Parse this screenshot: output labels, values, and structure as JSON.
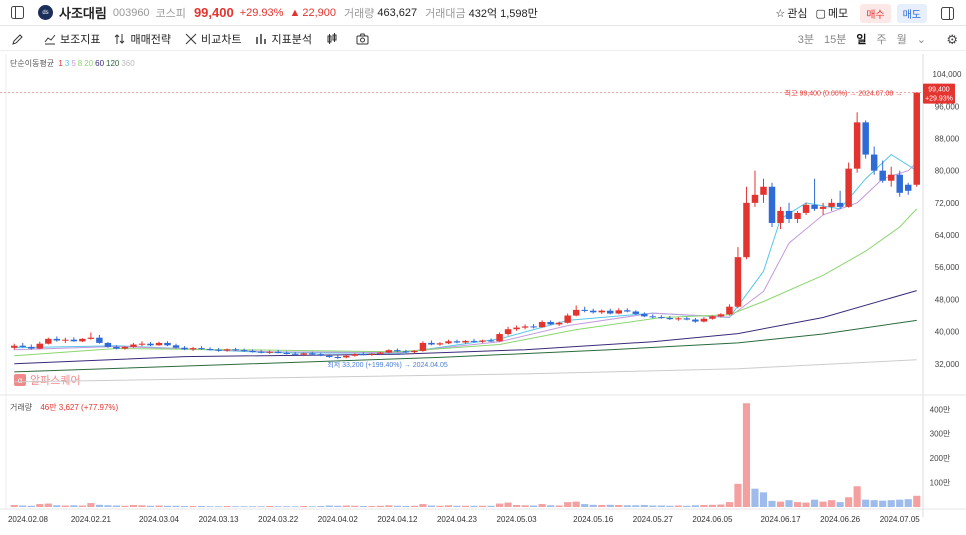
{
  "header": {
    "logo_text": "ds",
    "name": "사조대림",
    "code": "003960",
    "market": "코스피",
    "price": "99,400",
    "change_pct": "+29.93%",
    "change_abs": "22,900",
    "volume_label": "거래량",
    "volume": "463,627",
    "amount_label": "거래대금",
    "amount": "432억 1,598만",
    "watch_label": "관심",
    "memo_label": "메모",
    "buy_label": "매수",
    "sell_label": "매도"
  },
  "toolbar": {
    "indicator_label": "보조지표",
    "strategy_label": "매매전략",
    "compare_label": "비교차트",
    "analysis_label": "지표분석",
    "periods": [
      "3분",
      "15분",
      "일",
      "주",
      "월"
    ],
    "active_period": "일"
  },
  "legend": {
    "ma_title": "단순이동평균",
    "ma_items": [
      {
        "label": "1",
        "color": "#e3342f"
      },
      {
        "label": "3",
        "color": "#56c7e8"
      },
      {
        "label": "5",
        "color": "#c59be0"
      },
      {
        "label": "8",
        "color": "#8bd66e"
      },
      {
        "label": "20",
        "color": "#8bd66e"
      },
      {
        "label": "60",
        "color": "#3b2a7a"
      },
      {
        "label": "120",
        "color": "#2b6b3c"
      },
      {
        "label": "360",
        "color": "#bbbbbb"
      }
    ],
    "watermark": "알파스퀘어",
    "vol_title": "거래량",
    "vol_value": "46만 3,627 (+77.97%)"
  },
  "annotations": {
    "high": "최고 99,400 (0.00%) → 2024.07.08 →",
    "low": "최저 33,200 (+199.40%) → 2024.04.05",
    "last_price": "99,400",
    "last_pct": "+29.93%"
  },
  "colors": {
    "up": "#e3342f",
    "down": "#2f6bd6",
    "vol_up": "#f4a0a0",
    "vol_down": "#9dbbeb"
  },
  "chart_data": {
    "type": "candlestick",
    "price_axis_labels": [
      "104,000",
      "96,000",
      "88,000",
      "80,000",
      "72,000",
      "64,000",
      "56,000",
      "48,000",
      "40,000",
      "32,000"
    ],
    "price_ticks": [
      104000,
      96000,
      88000,
      80000,
      72000,
      64000,
      56000,
      48000,
      40000,
      32000
    ],
    "price_range": [
      25000,
      107000
    ],
    "volume_axis_labels": [
      "400만",
      "300만",
      "200만",
      "100만"
    ],
    "volume_ticks": [
      400,
      300,
      200,
      100
    ],
    "volume_range": [
      0,
      430
    ],
    "date_labels": [
      "2024.02.08",
      "2024.02.21",
      "2024.03.04",
      "2024.03.13",
      "2024.03.22",
      "2024.04.02",
      "2024.04.12",
      "2024.04.23",
      "2024.05.03",
      "2024.05.16",
      "2024.05.27",
      "2024.06.05",
      "2024.06.17",
      "2024.06.26",
      "2024.07.05"
    ],
    "date_label_index": [
      0,
      9,
      17,
      24,
      31,
      38,
      45,
      52,
      59,
      68,
      75,
      82,
      90,
      97,
      104
    ],
    "candles": [
      [
        36000,
        37000,
        35500,
        36500
      ],
      [
        36500,
        37200,
        36000,
        36200
      ],
      [
        36200,
        36800,
        35500,
        35800
      ],
      [
        35800,
        37500,
        35600,
        37000
      ],
      [
        37000,
        38500,
        36800,
        38200
      ],
      [
        38200,
        38800,
        37500,
        37800
      ],
      [
        37800,
        38500,
        37200,
        38000
      ],
      [
        38000,
        38600,
        37500,
        37600
      ],
      [
        37600,
        38400,
        37400,
        38200
      ],
      [
        38200,
        39800,
        38000,
        38500
      ],
      [
        38500,
        39200,
        37000,
        37200
      ],
      [
        37200,
        37400,
        36000,
        36200
      ],
      [
        36200,
        36600,
        35600,
        35800
      ],
      [
        35800,
        36400,
        35500,
        36200
      ],
      [
        36200,
        37200,
        36000,
        36800
      ],
      [
        36800,
        37600,
        36400,
        37000
      ],
      [
        37000,
        37400,
        36400,
        36600
      ],
      [
        36600,
        37500,
        36500,
        37200
      ],
      [
        37200,
        37600,
        36400,
        36600
      ],
      [
        36600,
        37000,
        35800,
        36000
      ],
      [
        36000,
        36400,
        35400,
        35600
      ],
      [
        35600,
        36200,
        35200,
        35900
      ],
      [
        35900,
        36400,
        35500,
        35700
      ],
      [
        35700,
        36100,
        35300,
        35500
      ],
      [
        35500,
        35900,
        35000,
        35300
      ],
      [
        35300,
        35800,
        35000,
        35600
      ],
      [
        35600,
        36000,
        35200,
        35400
      ],
      [
        35400,
        35800,
        35000,
        35200
      ],
      [
        35200,
        35600,
        34800,
        35000
      ],
      [
        35000,
        35400,
        34600,
        34800
      ],
      [
        34800,
        35300,
        34500,
        35000
      ],
      [
        35000,
        35400,
        34600,
        34700
      ],
      [
        34700,
        35100,
        34300,
        34500
      ],
      [
        34500,
        34900,
        34100,
        34300
      ],
      [
        34300,
        34800,
        33900,
        34600
      ],
      [
        34600,
        35000,
        34200,
        34400
      ],
      [
        34400,
        34700,
        33900,
        34000
      ],
      [
        34000,
        34400,
        33500,
        33700
      ],
      [
        33700,
        34100,
        33200,
        33600
      ],
      [
        33600,
        34200,
        33400,
        34000
      ],
      [
        34000,
        34600,
        33800,
        34400
      ],
      [
        34400,
        34900,
        34100,
        34300
      ],
      [
        34300,
        34700,
        34000,
        34500
      ],
      [
        34500,
        35000,
        34300,
        34800
      ],
      [
        34800,
        35600,
        34600,
        35400
      ],
      [
        35400,
        35800,
        34900,
        35100
      ],
      [
        35100,
        35500,
        34700,
        34900
      ],
      [
        34900,
        35400,
        34600,
        35200
      ],
      [
        35200,
        37600,
        35000,
        37200
      ],
      [
        37200,
        37800,
        36600,
        36800
      ],
      [
        36800,
        37400,
        36500,
        37100
      ],
      [
        37100,
        38000,
        36900,
        37600
      ],
      [
        37600,
        38000,
        37100,
        37300
      ],
      [
        37300,
        37900,
        37000,
        37700
      ],
      [
        37700,
        38200,
        37300,
        37500
      ],
      [
        37500,
        38000,
        37200,
        37800
      ],
      [
        37800,
        38300,
        37400,
        37600
      ],
      [
        37600,
        39800,
        37500,
        39400
      ],
      [
        39400,
        41200,
        39000,
        40600
      ],
      [
        40600,
        41500,
        40200,
        41000
      ],
      [
        41000,
        41800,
        40600,
        41300
      ],
      [
        41300,
        41900,
        40800,
        41100
      ],
      [
        41100,
        42800,
        41000,
        42400
      ],
      [
        42400,
        42800,
        41600,
        41800
      ],
      [
        41800,
        42500,
        41400,
        42200
      ],
      [
        42200,
        44500,
        42000,
        44000
      ],
      [
        44000,
        46500,
        43800,
        45400
      ],
      [
        45400,
        46200,
        44800,
        45200
      ],
      [
        45200,
        45700,
        44500,
        44800
      ],
      [
        44800,
        45500,
        44400,
        45200
      ],
      [
        45200,
        45700,
        44300,
        44500
      ],
      [
        44500,
        45800,
        44300,
        45300
      ],
      [
        45300,
        45800,
        44800,
        45000
      ],
      [
        45000,
        45300,
        44200,
        44400
      ],
      [
        44400,
        44800,
        43600,
        43800
      ],
      [
        43800,
        44300,
        43300,
        43600
      ],
      [
        43600,
        44100,
        43200,
        43400
      ],
      [
        43400,
        43900,
        42900,
        43100
      ],
      [
        43100,
        43600,
        42700,
        43300
      ],
      [
        43300,
        43700,
        42800,
        43000
      ],
      [
        43000,
        43400,
        42200,
        42500
      ],
      [
        42500,
        43600,
        42300,
        43200
      ],
      [
        43200,
        44000,
        43000,
        43800
      ],
      [
        43800,
        44600,
        43500,
        44300
      ],
      [
        44300,
        46800,
        44000,
        46200
      ],
      [
        46200,
        61000,
        45800,
        58500
      ],
      [
        58500,
        76000,
        58000,
        72000
      ],
      [
        72000,
        80000,
        71000,
        74000
      ],
      [
        74000,
        78000,
        72000,
        76000
      ],
      [
        76000,
        77000,
        66000,
        67000
      ],
      [
        67000,
        71000,
        65500,
        70000
      ],
      [
        70000,
        72000,
        67000,
        68000
      ],
      [
        68000,
        70000,
        67000,
        69500
      ],
      [
        69500,
        72000,
        69000,
        71500
      ],
      [
        71500,
        78000,
        70000,
        70500
      ],
      [
        70500,
        72000,
        69000,
        71000
      ],
      [
        71000,
        73000,
        70000,
        72000
      ],
      [
        72000,
        75000,
        70500,
        71000
      ],
      [
        71000,
        82000,
        70800,
        80500
      ],
      [
        80500,
        94500,
        79500,
        92000
      ],
      [
        92000,
        92500,
        83000,
        84000
      ],
      [
        84000,
        86000,
        79000,
        80000
      ],
      [
        80000,
        82500,
        77000,
        77500
      ],
      [
        77500,
        81000,
        76000,
        79000
      ],
      [
        79000,
        80000,
        73500,
        74500
      ],
      [
        76500,
        77000,
        74000,
        75000
      ],
      [
        76500,
        99400,
        76000,
        99400
      ]
    ],
    "volume": [
      [
        8,
        0
      ],
      [
        6,
        1
      ],
      [
        5,
        1
      ],
      [
        12,
        0
      ],
      [
        14,
        0
      ],
      [
        7,
        1
      ],
      [
        6,
        0
      ],
      [
        7,
        1
      ],
      [
        6,
        0
      ],
      [
        16,
        0
      ],
      [
        9,
        1
      ],
      [
        7,
        1
      ],
      [
        6,
        1
      ],
      [
        5,
        0
      ],
      [
        8,
        0
      ],
      [
        7,
        0
      ],
      [
        5,
        1
      ],
      [
        6,
        0
      ],
      [
        5,
        1
      ],
      [
        5,
        1
      ],
      [
        4,
        1
      ],
      [
        4,
        0
      ],
      [
        4,
        1
      ],
      [
        3,
        1
      ],
      [
        3,
        1
      ],
      [
        4,
        0
      ],
      [
        3,
        1
      ],
      [
        3,
        1
      ],
      [
        3,
        1
      ],
      [
        3,
        1
      ],
      [
        4,
        0
      ],
      [
        3,
        1
      ],
      [
        3,
        1
      ],
      [
        3,
        1
      ],
      [
        4,
        0
      ],
      [
        3,
        1
      ],
      [
        4,
        1
      ],
      [
        6,
        1
      ],
      [
        5,
        1
      ],
      [
        6,
        0
      ],
      [
        5,
        0
      ],
      [
        4,
        1
      ],
      [
        4,
        0
      ],
      [
        5,
        0
      ],
      [
        7,
        0
      ],
      [
        5,
        1
      ],
      [
        4,
        1
      ],
      [
        5,
        0
      ],
      [
        12,
        0
      ],
      [
        6,
        1
      ],
      [
        5,
        0
      ],
      [
        7,
        0
      ],
      [
        5,
        1
      ],
      [
        5,
        0
      ],
      [
        5,
        1
      ],
      [
        5,
        0
      ],
      [
        5,
        1
      ],
      [
        14,
        0
      ],
      [
        18,
        0
      ],
      [
        8,
        0
      ],
      [
        7,
        0
      ],
      [
        6,
        1
      ],
      [
        12,
        0
      ],
      [
        7,
        1
      ],
      [
        6,
        0
      ],
      [
        20,
        0
      ],
      [
        22,
        0
      ],
      [
        12,
        1
      ],
      [
        9,
        1
      ],
      [
        8,
        0
      ],
      [
        9,
        1
      ],
      [
        8,
        0
      ],
      [
        7,
        1
      ],
      [
        7,
        1
      ],
      [
        8,
        1
      ],
      [
        6,
        1
      ],
      [
        6,
        1
      ],
      [
        5,
        1
      ],
      [
        6,
        0
      ],
      [
        5,
        1
      ],
      [
        7,
        1
      ],
      [
        8,
        0
      ],
      [
        9,
        0
      ],
      [
        10,
        0
      ],
      [
        20,
        0
      ],
      [
        95,
        0
      ],
      [
        425,
        0
      ],
      [
        75,
        1
      ],
      [
        60,
        1
      ],
      [
        25,
        1
      ],
      [
        22,
        0
      ],
      [
        28,
        1
      ],
      [
        20,
        0
      ],
      [
        18,
        0
      ],
      [
        30,
        1
      ],
      [
        22,
        0
      ],
      [
        28,
        0
      ],
      [
        20,
        1
      ],
      [
        40,
        0
      ],
      [
        85,
        0
      ],
      [
        30,
        1
      ],
      [
        28,
        1
      ],
      [
        26,
        1
      ],
      [
        28,
        1
      ],
      [
        30,
        1
      ],
      [
        32,
        1
      ],
      [
        46,
        0
      ]
    ],
    "ma_lines": [
      {
        "color": "#56c7e8",
        "points": [
          [
            0,
            36000
          ],
          [
            12,
            36500
          ],
          [
            30,
            34800
          ],
          [
            45,
            34600
          ],
          [
            57,
            38200
          ],
          [
            65,
            42800
          ],
          [
            75,
            44600
          ],
          [
            84,
            43500
          ],
          [
            88,
            55000
          ],
          [
            90,
            68000
          ],
          [
            93,
            72000
          ],
          [
            97,
            70500
          ],
          [
            100,
            78000
          ],
          [
            103,
            84000
          ],
          [
            106,
            80000
          ]
        ]
      },
      {
        "color": "#c59be0",
        "points": [
          [
            0,
            35500
          ],
          [
            12,
            36300
          ],
          [
            30,
            35000
          ],
          [
            45,
            34800
          ],
          [
            57,
            37500
          ],
          [
            65,
            41500
          ],
          [
            75,
            44600
          ],
          [
            84,
            43600
          ],
          [
            88,
            50000
          ],
          [
            91,
            62000
          ],
          [
            95,
            69000
          ],
          [
            99,
            72000
          ],
          [
            102,
            78000
          ],
          [
            105,
            80000
          ],
          [
            106,
            82000
          ]
        ]
      },
      {
        "color": "#8bd66e",
        "points": [
          [
            0,
            34000
          ],
          [
            12,
            35800
          ],
          [
            30,
            35400
          ],
          [
            45,
            35000
          ],
          [
            57,
            36800
          ],
          [
            66,
            40500
          ],
          [
            76,
            43500
          ],
          [
            84,
            44200
          ],
          [
            88,
            47500
          ],
          [
            95,
            54000
          ],
          [
            100,
            60000
          ],
          [
            104,
            66000
          ],
          [
            106,
            70500
          ]
        ]
      },
      {
        "color": "#3b2a7a",
        "points": [
          [
            0,
            32000
          ],
          [
            20,
            33800
          ],
          [
            45,
            34400
          ],
          [
            60,
            35500
          ],
          [
            75,
            37500
          ],
          [
            85,
            39500
          ],
          [
            95,
            43500
          ],
          [
            106,
            50200
          ]
        ]
      },
      {
        "color": "#2b6b3c",
        "points": [
          [
            0,
            30000
          ],
          [
            25,
            31800
          ],
          [
            50,
            33600
          ],
          [
            70,
            35500
          ],
          [
            85,
            37200
          ],
          [
            95,
            39400
          ],
          [
            106,
            42800
          ]
        ]
      },
      {
        "color": "#cccccc",
        "points": [
          [
            0,
            27500
          ],
          [
            30,
            28500
          ],
          [
            60,
            29500
          ],
          [
            85,
            30800
          ],
          [
            106,
            33000
          ]
        ]
      }
    ]
  }
}
